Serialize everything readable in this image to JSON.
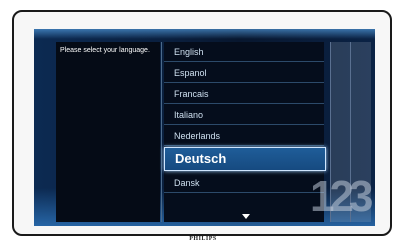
{
  "prompt": "Please select your language.",
  "languages": [
    "English",
    "Espanol",
    "Francais",
    "Italiano",
    "Nederlands",
    "Deutsch",
    "Dansk"
  ],
  "selected_language": "Deutsch",
  "page_indicator": "123",
  "brand": "PHILIPS",
  "colors": {
    "selection_fill": "#1f5d99",
    "selection_border": "#cfe6ff",
    "screen_background": "#0a1f3e"
  }
}
